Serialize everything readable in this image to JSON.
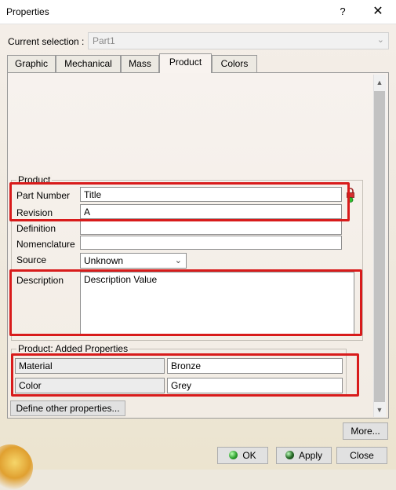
{
  "window": {
    "title": "Properties",
    "help_label": "?",
    "close_label": "✕"
  },
  "current_selection": {
    "label": "Current selection :",
    "value": "Part1"
  },
  "tabs": [
    {
      "label": "Graphic",
      "active": false
    },
    {
      "label": "Mechanical",
      "active": false
    },
    {
      "label": "Mass",
      "active": false
    },
    {
      "label": "Product",
      "active": true
    },
    {
      "label": "Colors",
      "active": false
    }
  ],
  "product_group": {
    "title": "Product",
    "part_number": {
      "label": "Part Number",
      "value": "Title"
    },
    "revision": {
      "label": "Revision",
      "value": "A"
    },
    "definition": {
      "label": "Definition",
      "value": ""
    },
    "nomenclature": {
      "label": "Nomenclature",
      "value": ""
    },
    "source": {
      "label": "Source",
      "value": "Unknown"
    },
    "description": {
      "label": "Description",
      "value": "Description Value"
    }
  },
  "added_properties": {
    "title": "Product: Added Properties",
    "rows": [
      {
        "name": "Material",
        "value": "Bronze"
      },
      {
        "name": "Color",
        "value": "Grey"
      }
    ]
  },
  "buttons": {
    "define_other": "Define other properties...",
    "more": "More...",
    "ok": "OK",
    "apply": "Apply",
    "close": "Close"
  },
  "colors": {
    "highlight_box": "#d81b1b"
  }
}
